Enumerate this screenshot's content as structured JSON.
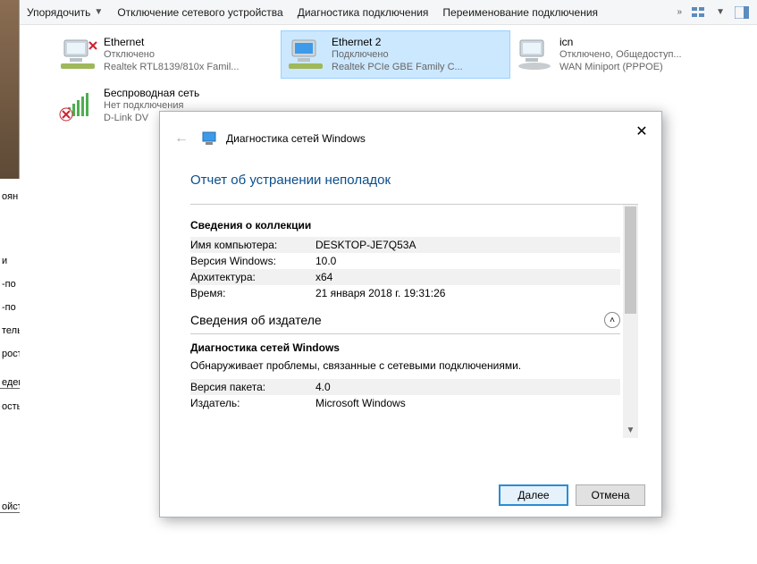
{
  "toolbar": {
    "organize": "Упорядочить",
    "disable": "Отключение сетевого устройства",
    "diagnose": "Диагностика подключения",
    "rename": "Переименование подключения"
  },
  "adapters": [
    {
      "name": "Ethernet",
      "status": "Отключено",
      "desc": "Realtek RTL8139/810x Famil...",
      "type": "eth-disabled"
    },
    {
      "name": "Ethernet 2",
      "status": "Подключено",
      "desc": "Realtek PCIe GBE Family C...",
      "type": "eth-enabled",
      "selected": true
    },
    {
      "name": "icn",
      "status": "Отключено, Общедоступ...",
      "desc": "WAN Miniport (PPPOE)",
      "type": "wan"
    },
    {
      "name": "Беспроводная сеть",
      "status": "Нет подключения",
      "desc": "D-Link DV",
      "type": "wifi-none"
    }
  ],
  "left_fragments": [
    "оян",
    "",
    "",
    "",
    "и",
    "-по",
    "-по",
    "тель",
    "рост",
    "",
    "еден",
    "ость",
    "",
    "",
    "",
    "",
    "ойст",
    ""
  ],
  "dialog": {
    "title": "Диагностика сетей Windows",
    "report_title": "Отчет об устранении неполадок",
    "section_collection": "Сведения о коллекции",
    "computer_name_label": "Имя компьютера:",
    "computer_name": "DESKTOP-JE7Q53A",
    "win_version_label": "Версия Windows:",
    "win_version": "10.0",
    "arch_label": "Архитектура:",
    "arch": "x64",
    "time_label": "Время:",
    "time": "21 января 2018 г. 19:31:26",
    "section_publisher": "Сведения об издателе",
    "pack_title": "Диагностика сетей Windows",
    "pack_desc": "Обнаруживает проблемы, связанные с сетевыми подключениями.",
    "pack_ver_label": "Версия пакета:",
    "pack_ver": "4.0",
    "publisher_label": "Издатель:",
    "publisher": "Microsoft Windows",
    "btn_next": "Далее",
    "btn_cancel": "Отмена"
  }
}
